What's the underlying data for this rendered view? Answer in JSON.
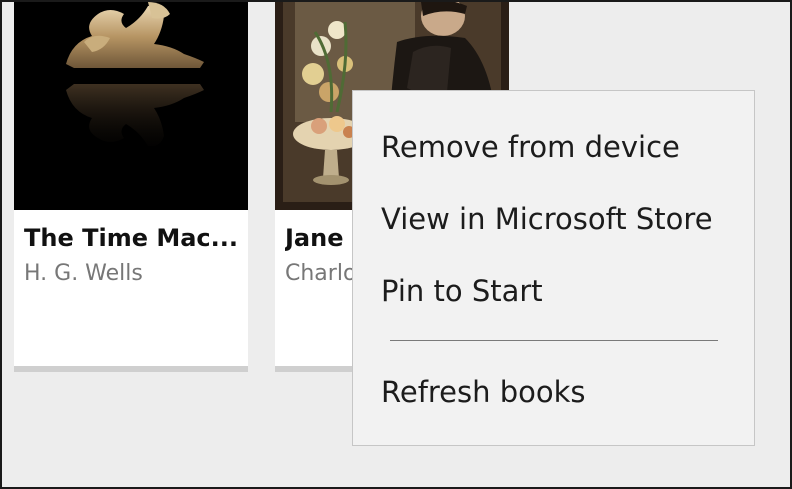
{
  "books": [
    {
      "title": "The Time Mac...",
      "author": "H. G. Wells",
      "cover_icon": "sphinx-statue"
    },
    {
      "title": "Jane",
      "author": "Charlo",
      "cover_icon": "painting-woman-flowers"
    }
  ],
  "context_menu": {
    "items": [
      {
        "label": "Remove from device"
      },
      {
        "label": "View in Microsoft Store"
      },
      {
        "label": "Pin to Start"
      },
      {
        "label": "Refresh books"
      }
    ]
  },
  "colors": {
    "background": "#ededed",
    "card": "#ffffff",
    "menu_background": "#f2f2f2",
    "author_text": "#777777"
  }
}
